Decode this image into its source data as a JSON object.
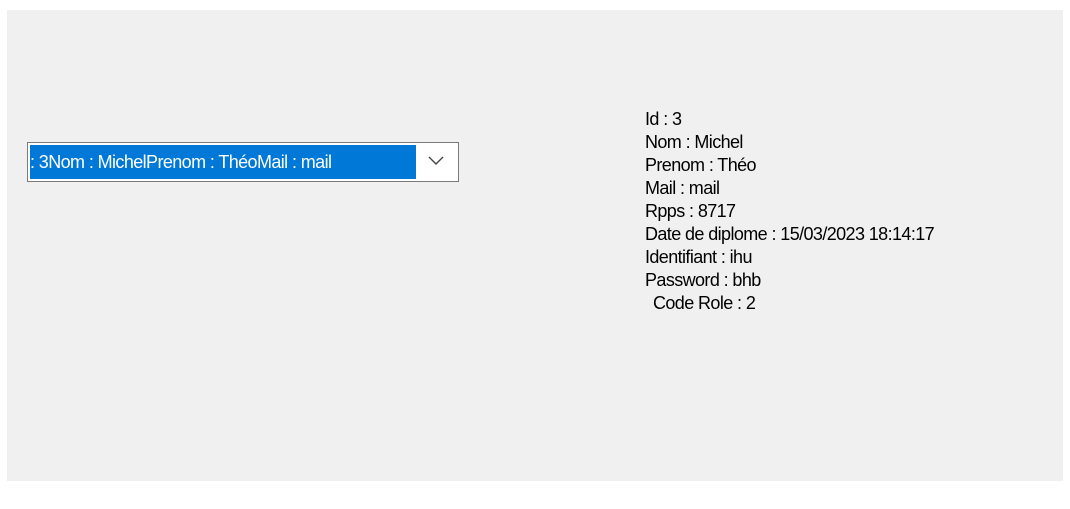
{
  "combo": {
    "selected_text": ": 3Nom : MichelPrenom : ThéoMail : mail"
  },
  "details": {
    "id": "Id : 3",
    "nom": "Nom : Michel",
    "prenom": "Prenom : Théo",
    "mail": "Mail : mail",
    "rpps": "Rpps : 8717",
    "date_diplome": "Date de diplome : 15/03/2023 18:14:17",
    "identifiant": "Identifiant : ihu",
    "password": "Password : bhb",
    "code_role": "Code Role : 2"
  },
  "colors": {
    "form_background": "#f0f0f0",
    "selection": "#0078d7"
  }
}
